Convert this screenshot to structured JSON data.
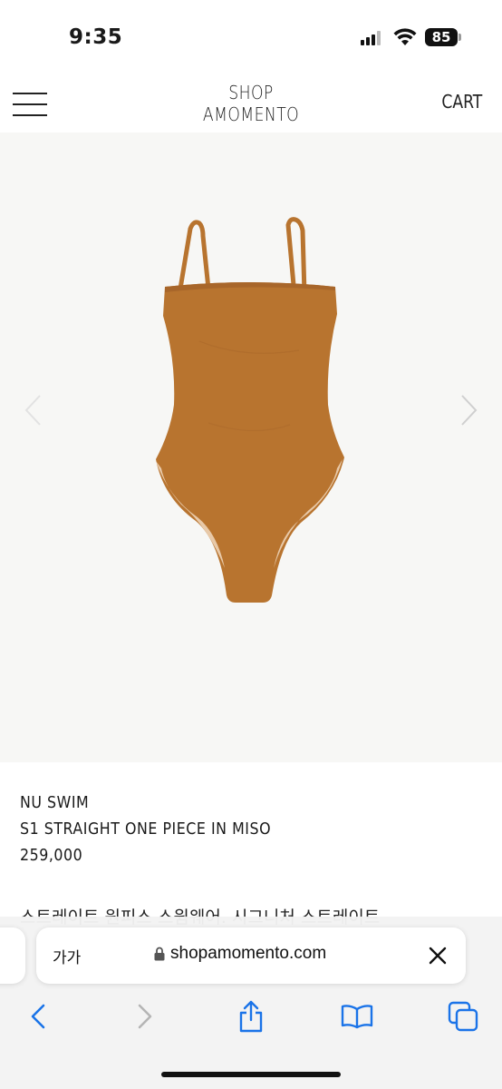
{
  "status_bar": {
    "time": "9:35",
    "battery": "85",
    "icons": [
      "cellular-signal-icon",
      "wifi-icon",
      "battery-icon"
    ]
  },
  "header": {
    "brand_line1": "SHOP",
    "brand_line2": "AMOMENTO",
    "cart_label": "CART",
    "menu_icon": "hamburger-menu-icon"
  },
  "product": {
    "image_icon": "swimsuit-image",
    "brand": "NU SWIM",
    "name": "S1 STRAIGHT ONE PIECE IN MISO",
    "price": "259,000",
    "description_partial": "스트레이트 원피스 스윔웨어. 시그니처 스트레이트",
    "carousel_icons": [
      "chevron-left-icon",
      "chevron-right-icon"
    ]
  },
  "safari": {
    "aa_label": "가가",
    "url": "shopamomento.com",
    "toolbar": [
      "back-icon",
      "forward-icon",
      "share-icon",
      "bookmarks-icon",
      "tabs-icon"
    ]
  },
  "colors": {
    "swimsuit": "#b8742f",
    "image_bg": "#f7f7f5",
    "safari_blue": "#1a73e8"
  }
}
